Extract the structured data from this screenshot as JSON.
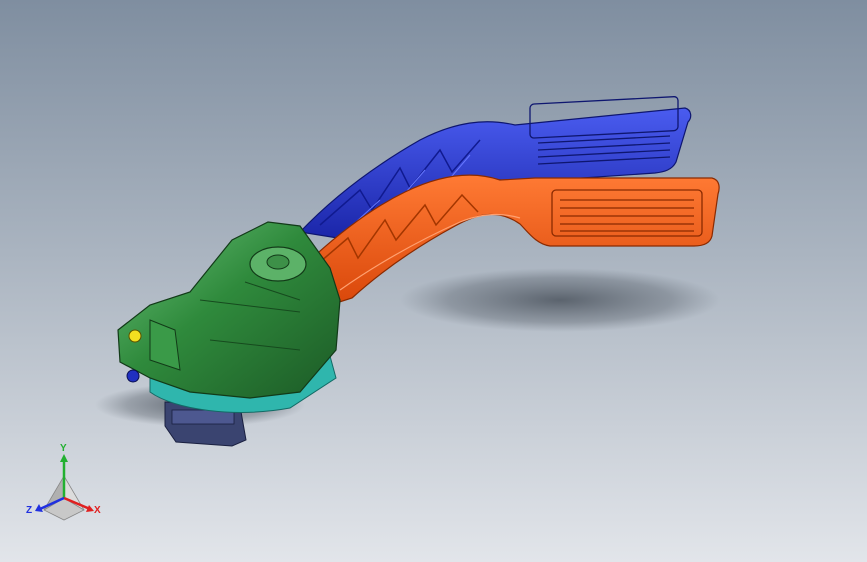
{
  "scene": {
    "background_top": "#7f8ea0",
    "background_bottom": "#e2e5ea",
    "parts": [
      {
        "name": "housing",
        "color": "#2f8a3c"
      },
      {
        "name": "pedal-arm-blue",
        "color": "#2233c8"
      },
      {
        "name": "pedal-arm-orange",
        "color": "#ee5a12"
      },
      {
        "name": "connector",
        "color": "#3a4470"
      },
      {
        "name": "seal-ring",
        "color": "#2fb6ad"
      }
    ]
  },
  "triad": {
    "x_label": "X",
    "y_label": "Y",
    "z_label": "Z",
    "x_color": "#e02020",
    "y_color": "#22b030",
    "z_color": "#2030e0"
  }
}
